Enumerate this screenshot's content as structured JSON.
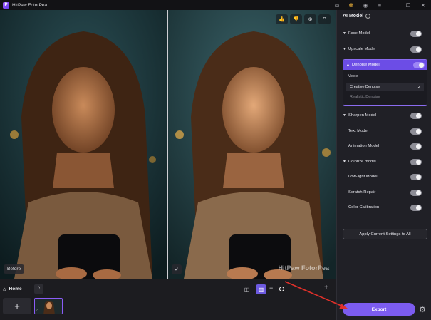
{
  "app": {
    "title": "HitPaw FotorPea"
  },
  "titlebar_icons": [
    "gift-icon",
    "cart-icon",
    "user-icon",
    "menu-icon",
    "minimize-icon",
    "maximize-icon",
    "close-icon"
  ],
  "preview": {
    "before_label": "Before",
    "watermark": "HitPaw FotorPea",
    "tools": [
      "thumbs-up-icon",
      "thumbs-down-icon",
      "zoom-icon",
      "crop-icon"
    ]
  },
  "bottom": {
    "home_label": "Home",
    "add_label": "+"
  },
  "panel": {
    "title": "AI Model",
    "models": [
      {
        "label": "Face Model",
        "caret": true,
        "on": true
      },
      {
        "label": "Upscale Model",
        "caret": true,
        "on": true
      },
      {
        "label": "Denoise Model",
        "caret": true,
        "on": true,
        "expanded": true
      },
      {
        "label": "Sharpen Model",
        "caret": true,
        "on": true
      },
      {
        "label": "Text Model",
        "caret": false,
        "on": true
      },
      {
        "label": "Animation Model",
        "caret": false,
        "on": true
      },
      {
        "label": "Colorize model",
        "caret": true,
        "on": true
      },
      {
        "label": "Low-light Model",
        "caret": false,
        "on": true
      },
      {
        "label": "Scratch Repair",
        "caret": false,
        "on": true
      },
      {
        "label": "Color Calibration",
        "caret": false,
        "on": true
      }
    ],
    "denoise": {
      "mode_label": "Mode",
      "options": [
        {
          "label": "Creative Denoise",
          "selected": true
        },
        {
          "label": "Realistic Denoise",
          "selected": false
        }
      ]
    },
    "apply_label": "Apply Current Settings to All",
    "export_label": "Export"
  },
  "colors": {
    "accent": "#7c5cf0",
    "panel_bg": "#202026",
    "annotation_arrow": "#e0302a"
  }
}
